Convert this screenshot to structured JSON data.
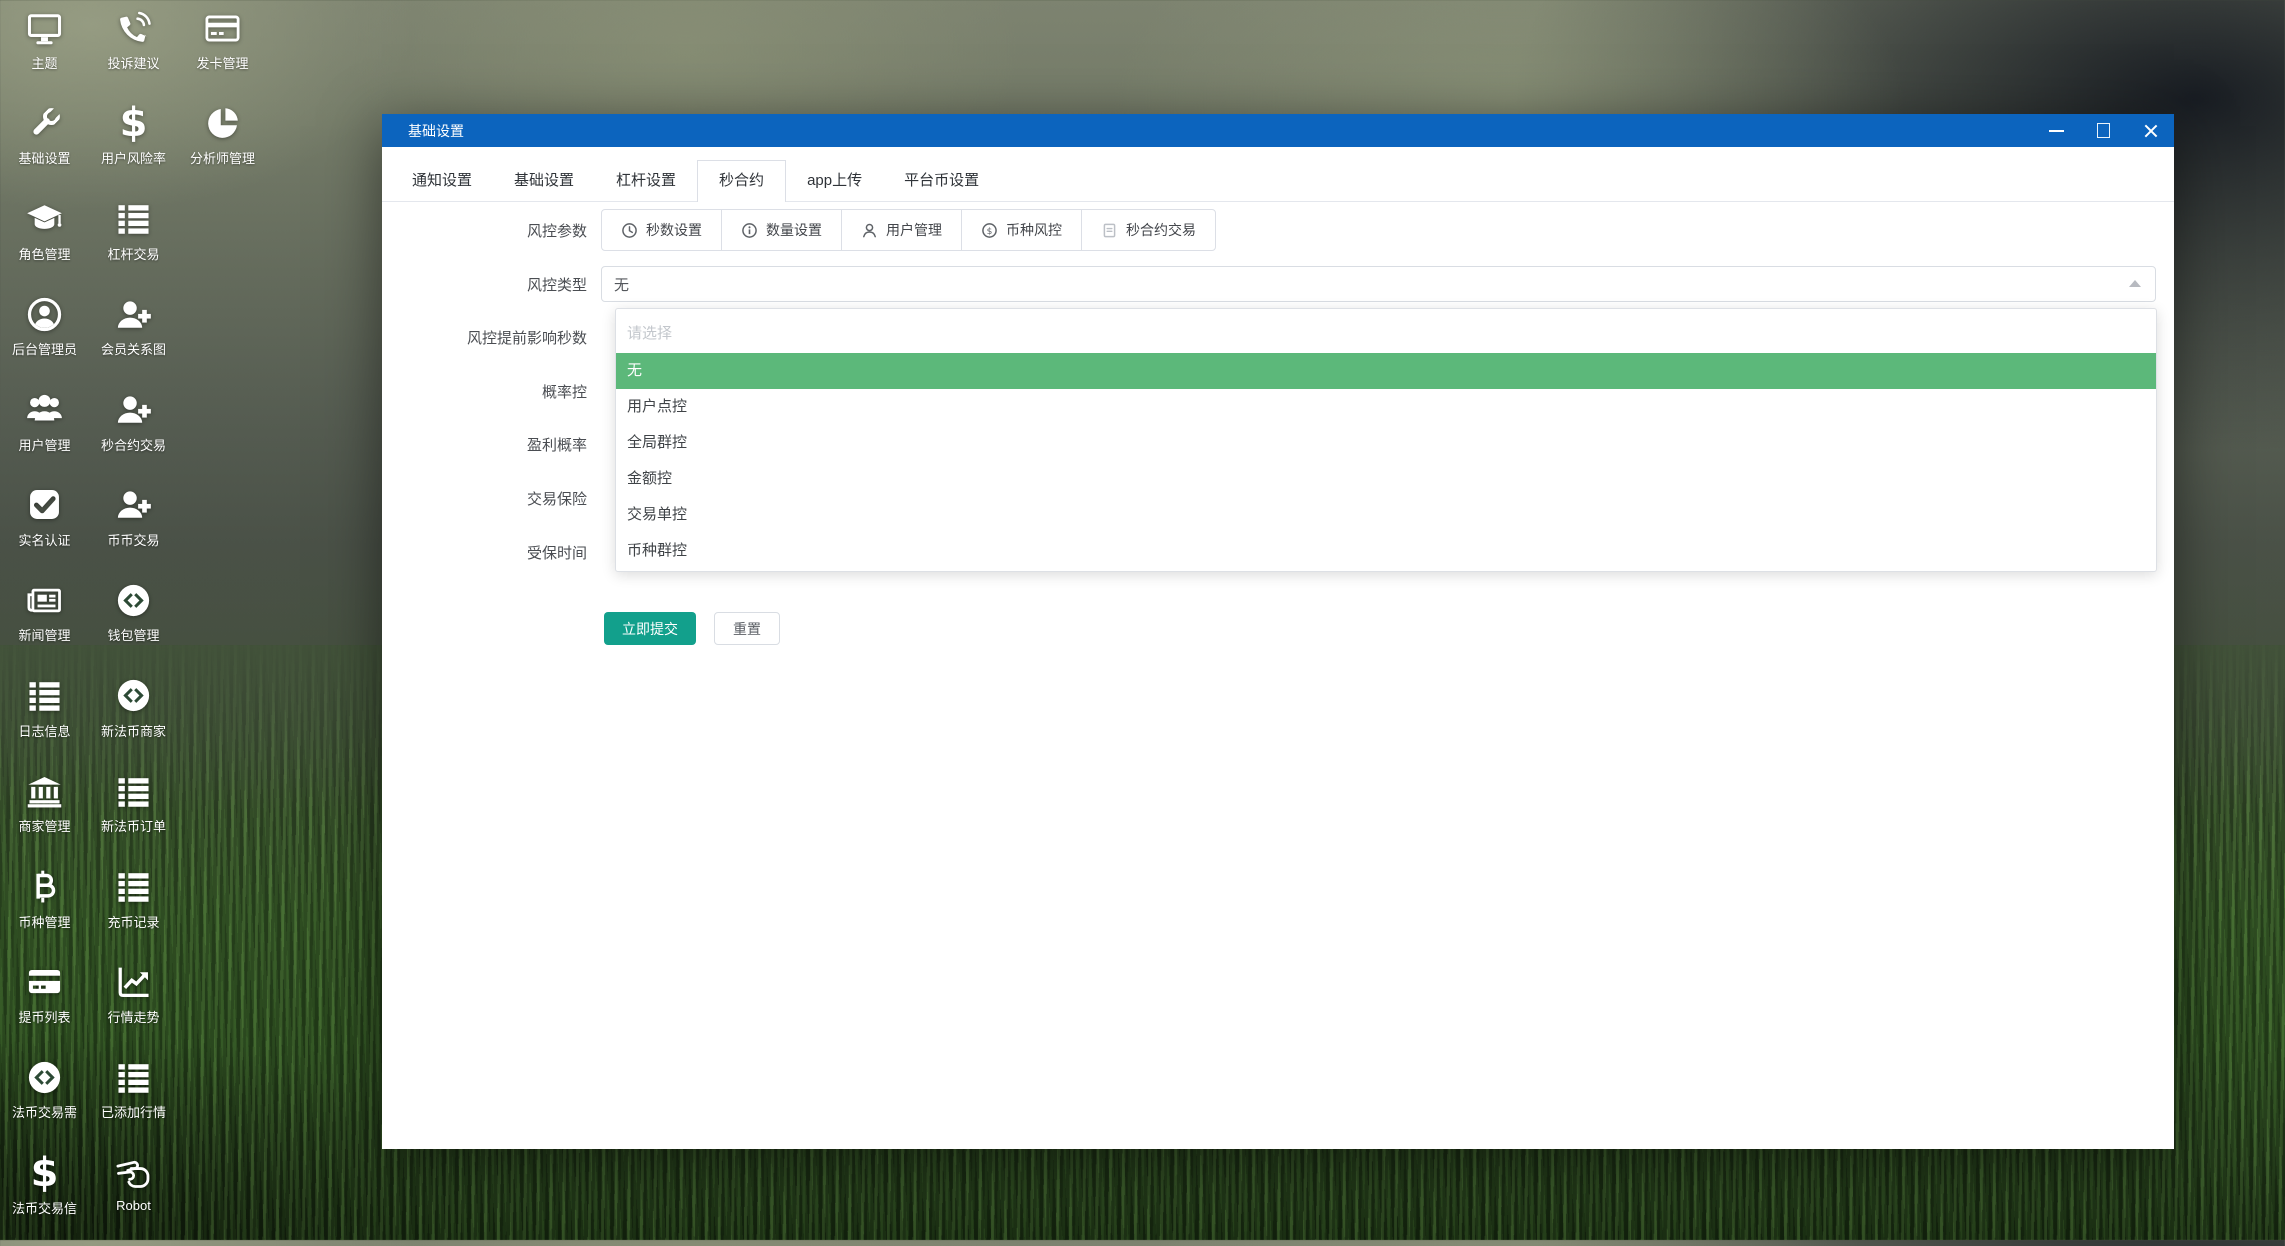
{
  "window": {
    "title": "基础设置"
  },
  "sidebar": {
    "items": [
      {
        "label": "主题",
        "icon": "monitor-icon"
      },
      {
        "label": "投诉建议",
        "icon": "phone-volume-icon"
      },
      {
        "label": "发卡管理",
        "icon": "credit-card-icon"
      },
      {
        "label": "基础设置",
        "icon": "wrench-icon"
      },
      {
        "label": "用户风险率",
        "icon": "dollar-icon"
      },
      {
        "label": "分析师管理",
        "icon": "pie-chart-icon"
      },
      {
        "label": "角色管理",
        "icon": "graduation-cap-icon"
      },
      {
        "label": "杠杆交易",
        "icon": "list-icon"
      },
      {
        "label": "后台管理员",
        "icon": "user-circle-icon"
      },
      {
        "label": "会员关系图",
        "icon": "user-plus-icon"
      },
      {
        "label": "用户管理",
        "icon": "users-icon"
      },
      {
        "label": "秒合约交易",
        "icon": "user-plus-icon"
      },
      {
        "label": "实名认证",
        "icon": "check-square-icon"
      },
      {
        "label": "币币交易",
        "icon": "user-plus-icon"
      },
      {
        "label": "新闻管理",
        "icon": "newspaper-icon"
      },
      {
        "label": "钱包管理",
        "icon": "coin-logo-icon"
      },
      {
        "label": "日志信息",
        "icon": "list-icon"
      },
      {
        "label": "新法币商家",
        "icon": "coin-logo-icon"
      },
      {
        "label": "商家管理",
        "icon": "bank-icon"
      },
      {
        "label": "新法币订单",
        "icon": "list-icon"
      },
      {
        "label": "币种管理",
        "icon": "bitcoin-icon"
      },
      {
        "label": "充币记录",
        "icon": "list-icon"
      },
      {
        "label": "提币列表",
        "icon": "card-solid-icon"
      },
      {
        "label": "行情走势",
        "icon": "chart-line-icon"
      },
      {
        "label": "法币交易需",
        "icon": "coin-logo-icon"
      },
      {
        "label": "已添加行情",
        "icon": "list-icon"
      },
      {
        "label": "法币交易信",
        "icon": "dollar-icon"
      },
      {
        "label": "Robot",
        "icon": "hand-scissors-icon"
      }
    ]
  },
  "tabs": {
    "items": [
      {
        "label": "通知设置"
      },
      {
        "label": "基础设置"
      },
      {
        "label": "杠杆设置"
      },
      {
        "label": "秒合约"
      },
      {
        "label": "app上传"
      },
      {
        "label": "平台币设置"
      }
    ],
    "active_index": 3
  },
  "form": {
    "labels": {
      "params": "风控参数",
      "type": "风控类型",
      "pre_seconds": "风控提前影响秒数",
      "probability": "概率控",
      "profit_probability": "盈利概率",
      "trade_insurance": "交易保险",
      "insured_time": "受保时间"
    },
    "param_buttons": [
      {
        "label": "秒数设置",
        "icon": "clock-icon"
      },
      {
        "label": "数量设置",
        "icon": "info-icon"
      },
      {
        "label": "用户管理",
        "icon": "user-icon"
      },
      {
        "label": "币种风控",
        "icon": "dollar-circle-icon"
      },
      {
        "label": "秒合约交易",
        "icon": "document-icon"
      }
    ],
    "type_select": {
      "value": "无"
    },
    "dropdown": {
      "placeholder": "请选择",
      "options": [
        "无",
        "用户点控",
        "全局群控",
        "金额控",
        "交易单控",
        "币种群控"
      ],
      "selected_index": 0
    },
    "actions": {
      "submit": "立即提交",
      "reset": "重置"
    }
  },
  "colors": {
    "titlebar_blue": "#0c64be",
    "option_selected_green": "#5cb87a",
    "submit_teal": "#12a08c"
  }
}
